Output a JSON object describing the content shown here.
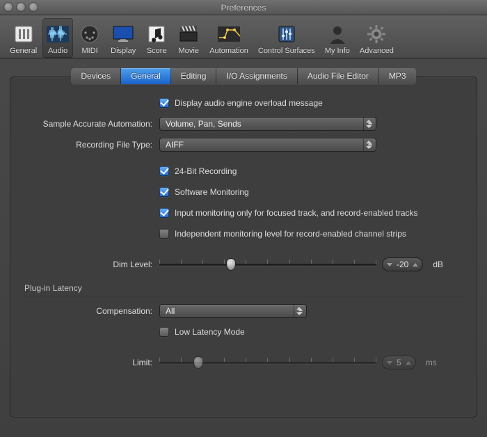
{
  "window": {
    "title": "Preferences"
  },
  "toolbar": {
    "items": [
      {
        "key": "general",
        "label": "General"
      },
      {
        "key": "audio",
        "label": "Audio",
        "selected": true
      },
      {
        "key": "midi",
        "label": "MIDI"
      },
      {
        "key": "display",
        "label": "Display"
      },
      {
        "key": "score",
        "label": "Score"
      },
      {
        "key": "movie",
        "label": "Movie"
      },
      {
        "key": "automation",
        "label": "Automation"
      },
      {
        "key": "control_surfaces",
        "label": "Control Surfaces"
      },
      {
        "key": "my_info",
        "label": "My Info"
      },
      {
        "key": "advanced",
        "label": "Advanced"
      }
    ]
  },
  "tabs": {
    "items": [
      {
        "key": "devices",
        "label": "Devices"
      },
      {
        "key": "general",
        "label": "General",
        "active": true
      },
      {
        "key": "editing",
        "label": "Editing"
      },
      {
        "key": "io",
        "label": "I/O Assignments"
      },
      {
        "key": "audio_file_editor",
        "label": "Audio File Editor"
      },
      {
        "key": "mp3",
        "label": "MP3"
      }
    ]
  },
  "settings": {
    "overload_message": {
      "checked": true,
      "label": "Display audio engine overload message"
    },
    "sample_accurate_automation": {
      "label": "Sample Accurate Automation:",
      "value": "Volume, Pan, Sends"
    },
    "recording_file_type": {
      "label": "Recording File Type:",
      "value": "AIFF"
    },
    "bit24": {
      "checked": true,
      "label": "24-Bit Recording"
    },
    "swmon": {
      "checked": true,
      "label": "Software Monitoring"
    },
    "inputmon": {
      "checked": true,
      "label": "Input monitoring only for focused track, and record-enabled tracks"
    },
    "indmon": {
      "checked": false,
      "label": "Independent monitoring level for record-enabled channel strips"
    },
    "dim": {
      "label": "Dim Level:",
      "value": "-20",
      "unit": "dB",
      "percent": 33
    },
    "plugin_latency_header": "Plug-in Latency",
    "compensation": {
      "label": "Compensation:",
      "value": "All"
    },
    "low_latency": {
      "checked": false,
      "label": "Low Latency Mode"
    },
    "limit": {
      "label": "Limit:",
      "value": "5",
      "unit": "ms",
      "percent": 18,
      "disabled": true
    }
  }
}
